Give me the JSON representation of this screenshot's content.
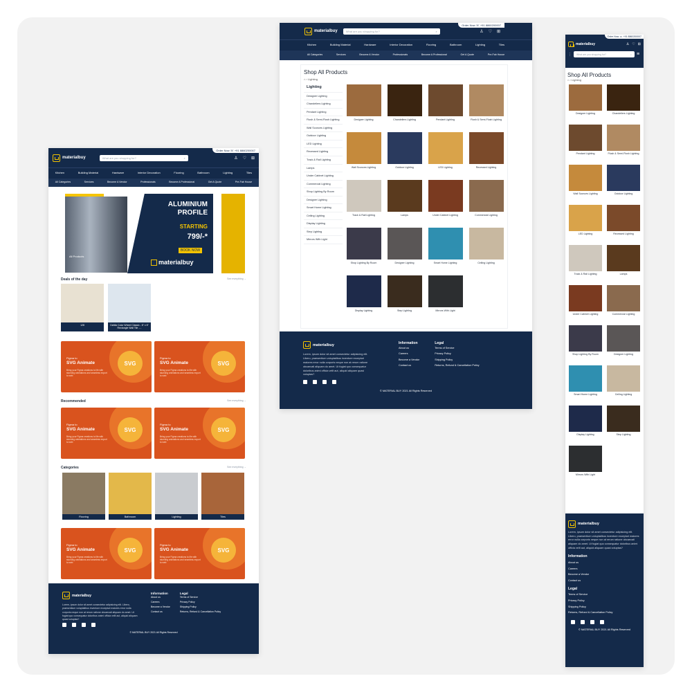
{
  "brand": {
    "name": "materialbuy",
    "accent": "#f5c400",
    "navy": "#142a4a",
    "orange": "#d9531e"
  },
  "header": {
    "order_now": "Order Now",
    "phone": "+91 8860200007",
    "search_placeholder": "What are you shopping for?",
    "icons": [
      "user-icon",
      "heart-icon",
      "cart-icon"
    ],
    "nav": [
      "Kitchen",
      "Building Material",
      "Hardware",
      "Interior Decoration",
      "Flooring",
      "Bathroom",
      "Lighting",
      "Tiles"
    ],
    "subnav": [
      "All Categories",
      "Services",
      "Become A Vendor",
      "Professionals",
      "Become A Professional",
      "Get A Quote",
      "Pre-Fab House"
    ]
  },
  "home": {
    "hero": {
      "title1": "ALUMINIUM",
      "title2": "PROFILE",
      "starting": "STARTING",
      "price": "799/-*",
      "cta": "BOOK NOW",
      "tag": "All Products"
    },
    "deals": {
      "title": "Deals of the day",
      "see": "See everything →",
      "items": [
        {
          "label": "128"
        },
        {
          "label": "Dahlia Color Wheel Classic - 6\" x 6\" Rectangle Wall Tile -..."
        }
      ]
    },
    "banner": {
      "small": "Figma to",
      "title": "SVG Animate",
      "desc": "Bring your Figma creations to life with stunning animations and seamless export to web",
      "badge": "SVG"
    },
    "recommended": {
      "title": "Recommended",
      "see": "See everything →"
    },
    "categories": {
      "title": "Categories",
      "see": "See everything →",
      "items": [
        "Flooring",
        "Bathroom",
        "Lighting",
        "Tiles"
      ]
    }
  },
  "shop": {
    "title": "Shop All Products",
    "breadcrumb": "Lighting",
    "sidebar_title": "Lighting",
    "sidebar": [
      "Designer Lighting",
      "Chandeliers Lighting",
      "Pendant Lighting",
      "Flush & Semi-Flush Lighting",
      "Wall Sconces Lighting",
      "Outdoor Lighting",
      "LED Lighting",
      "Recessed Lighting",
      "Track & Rail Lighting",
      "Lamps",
      "Under Cabinet Lighting",
      "Commercial Lighting",
      "Shop Lighting By Room",
      "Designer Lighting",
      "Smart Home Lighting",
      "Ceiling Lighting",
      "Display Lighting",
      "Step Lighting",
      "Mirrors With Light"
    ],
    "products": [
      "Designer Lighting",
      "Chandeliers Lighting",
      "Pendant Lighting",
      "Flush & Semi-Flush Lighting",
      "Wall Sconces Lighting",
      "Outdoor Lighting",
      "LED Lighting",
      "Recessed Lighting",
      "Track & Rail Lighting",
      "Lamps",
      "Under Cabinet Lighting",
      "Commercial Lighting",
      "Shop Lighting By Room",
      "Designer Lighting",
      "Smart Home Lighting",
      "Ceiling Lighting",
      "Display Lighting",
      "Step Lighting",
      "Mirrors With Light"
    ]
  },
  "footer": {
    "about": "Lorem, ipsum dolor sit amet consectetur adipisicing elit. Libero, praesentium voluptatibus inventore excepturi maiores error nulla corporis neque non at rerum ratione obcaecati aliquam do amet. Ut fugiat quo consequatur doloribus animi officia velit aut, aliquid aliquam quasi voluptas?",
    "info_title": "Information",
    "info": [
      "About us",
      "Careers",
      "Become a Vendor",
      "Contact us"
    ],
    "legal_title": "Legal",
    "legal": [
      "Terms of Service",
      "Privacy Policy",
      "Shipping Policy",
      "Returns, Refund & Cancellation Policy"
    ],
    "copyright": "© MATERIAL BUY 2021 All Rights Reserved"
  },
  "image_colors": [
    "#9c6b3e",
    "#3a2410",
    "#6d4a2e",
    "#b08a62",
    "#c58a3c",
    "#2a3a5e",
    "#d9a34a",
    "#7b4a2a",
    "#cfc8bd",
    "#5a3a1e",
    "#7a3a20",
    "#8a6a4e",
    "#3b3a4a",
    "#5a5656",
    "#2f8fb0",
    "#c8b8a0",
    "#1e2a4a",
    "#3a2c1e",
    "#2c2e30"
  ]
}
